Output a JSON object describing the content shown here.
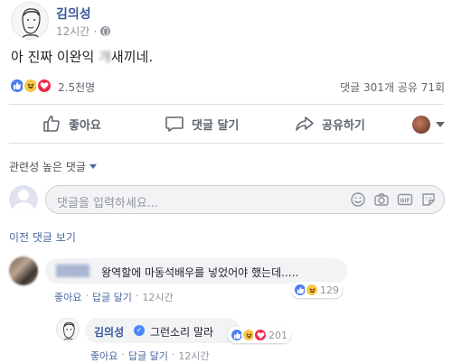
{
  "post": {
    "author": "김의성",
    "time": "12시간",
    "text": "아 진짜 이완익 ",
    "text_censored": "개",
    "text_end": "새끼네."
  },
  "reactions": {
    "icons": [
      "like-icon",
      "haha-icon",
      "love-icon"
    ],
    "count": "2.5천명",
    "comments_shares": "댓글 301개  공유 71회"
  },
  "actions": {
    "like": "좋아요",
    "comment": "댓글 달기",
    "share": "공유하기"
  },
  "comments": {
    "sort_label": "관련성 높은 댓글",
    "input_placeholder": "댓글을 입력하세요...",
    "previous": "이전 댓글 보기",
    "items": [
      {
        "name": "████",
        "text": "왕역할에 마동석배우를 넣었어야 했는데.....",
        "reaction_count": "129",
        "like_label": "좋아요",
        "reply_label": "답글 달기",
        "time": "12시간"
      },
      {
        "name": "김의성",
        "text": "그런소리 말라",
        "reaction_count": "201",
        "like_label": "좋아요",
        "reply_label": "답글 달기",
        "time": "12시간"
      }
    ]
  },
  "colors": {
    "link": "#365899",
    "muted": "#90949c",
    "like": "#4c7ef0",
    "love": "#f0284a",
    "haha": "#f7c84b"
  }
}
